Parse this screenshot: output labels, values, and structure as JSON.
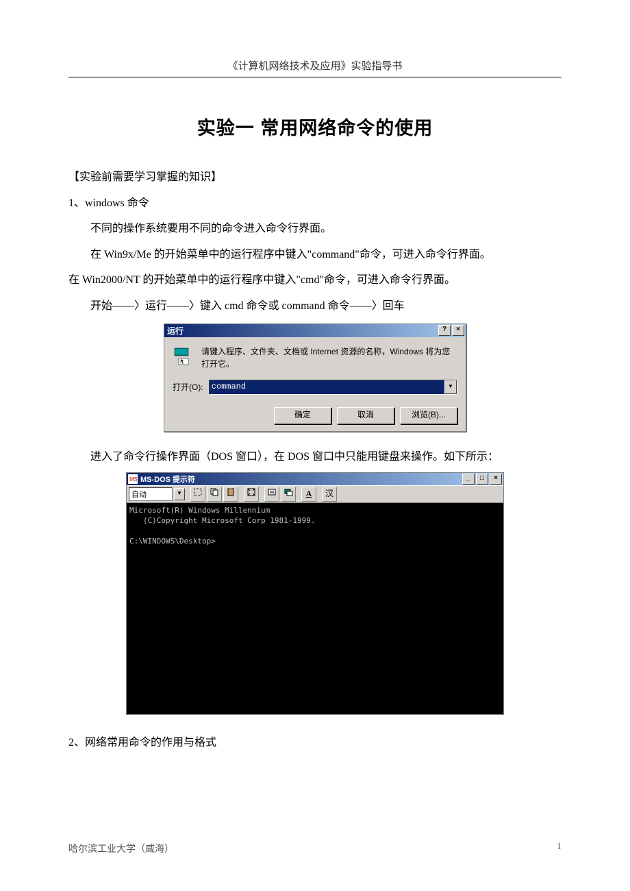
{
  "header": "《计算机网络技术及应用》实验指导书",
  "title": "实验一   常用网络命令的使用",
  "sections": {
    "prereq": "【实验前需要学习掌握的知识】",
    "h1": "1、windows 命令",
    "p1": "不同的操作系统要用不同的命令进入命令行界面。",
    "p2": "在 Win9x/Me 的开始菜单中的运行程序中键入\"command\"命令，可进入命令行界面。",
    "p3": "在 Win2000/NT 的开始菜单中的运行程序中键入\"cmd\"命令，可进入命令行界面。",
    "p4": "开始——〉运行——〉键入 cmd 命令或 command 命令——〉回车",
    "p5": "进入了命令行操作界面（DOS 窗口），在 DOS 窗口中只能用键盘来操作。如下所示：",
    "h2": "2、网络常用命令的作用与格式"
  },
  "runDialog": {
    "title": "运行",
    "help": "?",
    "close": "×",
    "desc": "请键入程序、文件夹、文档或 Internet 资源的名称，Windows 将为您打开它。",
    "openLabel": "打开(O):",
    "value": "command",
    "ok": "确定",
    "cancel": "取消",
    "browse": "浏览(B)..."
  },
  "dosWindow": {
    "title": "MS‑DOS 提示符",
    "min": "_",
    "max": "□",
    "close": "×",
    "fontSelect": "自动",
    "toolA": "A",
    "toolHan": "汉",
    "lines": [
      "Microsoft(R) Windows Millennium",
      "   (C)Copyright Microsoft Corp 1981-1999.",
      "",
      "C:\\WINDOWS\\Desktop>"
    ]
  },
  "footer": {
    "left": "哈尔滨工业大学（威海）",
    "right": "1"
  }
}
